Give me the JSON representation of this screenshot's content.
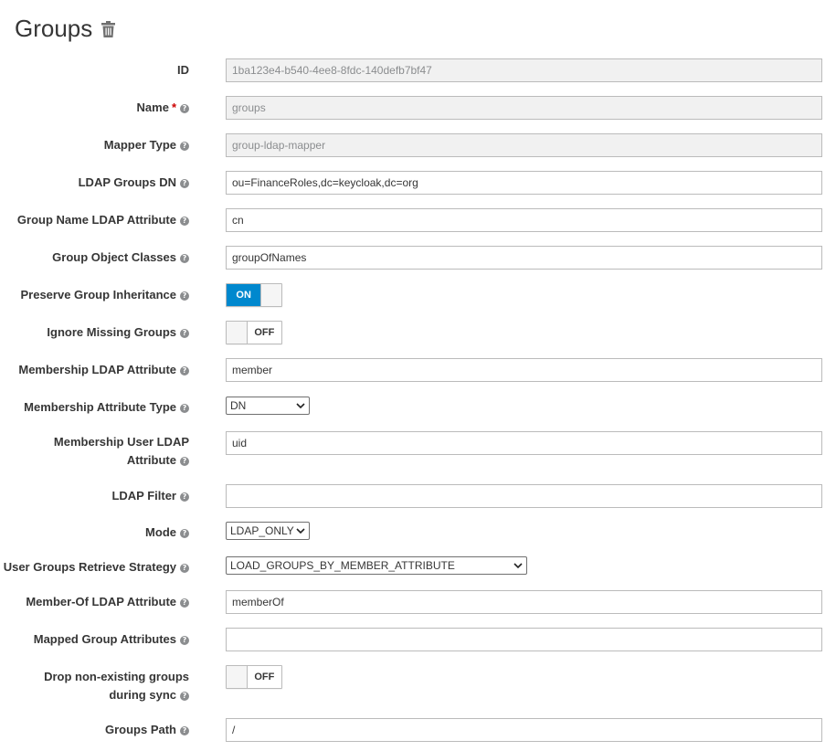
{
  "page": {
    "title": "Groups"
  },
  "fields": {
    "id": {
      "label": "ID",
      "value": "1ba123e4-b540-4ee8-8fdc-140defb7bf47"
    },
    "name": {
      "label": "Name",
      "required_mark": "*",
      "value": "groups"
    },
    "mapper_type": {
      "label": "Mapper Type",
      "value": "group-ldap-mapper"
    },
    "ldap_groups_dn": {
      "label": "LDAP Groups DN",
      "value": "ou=FinanceRoles,dc=keycloak,dc=org"
    },
    "group_name_attr": {
      "label": "Group Name LDAP Attribute",
      "value": "cn"
    },
    "group_object_classes": {
      "label": "Group Object Classes",
      "value": "groupOfNames"
    },
    "preserve_inheritance": {
      "label": "Preserve Group Inheritance",
      "state": "ON"
    },
    "ignore_missing": {
      "label": "Ignore Missing Groups",
      "state": "OFF"
    },
    "membership_attr": {
      "label": "Membership LDAP Attribute",
      "value": "member"
    },
    "membership_attr_type": {
      "label": "Membership Attribute Type",
      "value": "DN"
    },
    "membership_user_attr": {
      "label": "Membership User LDAP Attribute",
      "value": "uid"
    },
    "ldap_filter": {
      "label": "LDAP Filter",
      "value": ""
    },
    "mode": {
      "label": "Mode",
      "value": "LDAP_ONLY"
    },
    "retrieve_strategy": {
      "label": "User Groups Retrieve Strategy",
      "value": "LOAD_GROUPS_BY_MEMBER_ATTRIBUTE"
    },
    "member_of_attr": {
      "label": "Member-Of LDAP Attribute",
      "value": "memberOf"
    },
    "mapped_group_attrs": {
      "label": "Mapped Group Attributes",
      "value": ""
    },
    "drop_non_existing": {
      "label": "Drop non-existing groups during sync",
      "state": "OFF"
    },
    "groups_path": {
      "label": "Groups Path",
      "value": "/"
    }
  },
  "icons": {
    "help": "question-circle-icon",
    "delete": "trash-icon",
    "dropdown": "chevron-down-icon"
  },
  "colors": {
    "accent": "#0088ce",
    "required": "#cc0000"
  }
}
